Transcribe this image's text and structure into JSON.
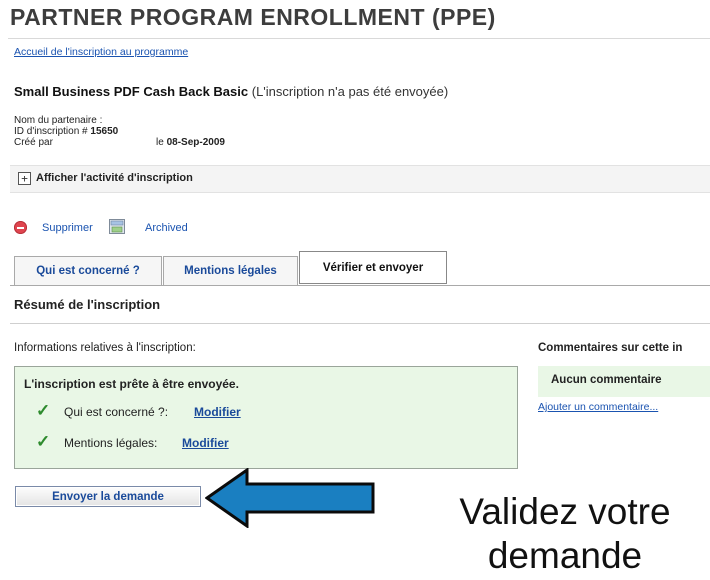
{
  "page": {
    "title": "PARTNER PROGRAM ENROLLMENT (PPE)",
    "breadcrumb": "Accueil de l'inscription au programme"
  },
  "program": {
    "name": "Small Business PDF Cash Back Basic",
    "status": "(L'inscription n'a pas été envoyée)"
  },
  "meta": {
    "partner_label": "Nom du partenaire :",
    "enrollment_label": "ID d'inscription #",
    "enrollment_id": "15650",
    "created_label": "Créé par",
    "created_prefix": "le",
    "created_date": "08-Sep-2009"
  },
  "activity": {
    "expand_symbol": "+",
    "label": "Afficher l'activité d'inscription"
  },
  "actions": {
    "delete_label": "Supprimer",
    "archived_label": "Archived"
  },
  "tabs": [
    {
      "label": "Qui est concerné ?"
    },
    {
      "label": "Mentions légales"
    },
    {
      "label": "Vérifier et envoyer"
    }
  ],
  "summary": {
    "title": "Résumé de l'inscription",
    "info_label": "Informations relatives à l'inscription:",
    "comments_label": "Commentaires sur cette in",
    "ready_text": "L'inscription est prête à être envoyée.",
    "check_symbol": "✓",
    "rows": [
      {
        "label": "Qui est concerné ?:",
        "link": "Modifier"
      },
      {
        "label": "Mentions légales:",
        "link": "Modifier"
      }
    ],
    "no_comment": "Aucun commentaire",
    "add_comment": "Ajouter un commentaire..."
  },
  "submit_button": "Envoyer la demande",
  "callout": {
    "line1": "Validez votre",
    "line2": "demande"
  },
  "colors": {
    "link": "#1a53b0",
    "success_bg": "#e9f7e6",
    "check": "#2e8b2e",
    "arrow_fill": "#1a7fc1",
    "delete_icon": "#e0454f"
  }
}
